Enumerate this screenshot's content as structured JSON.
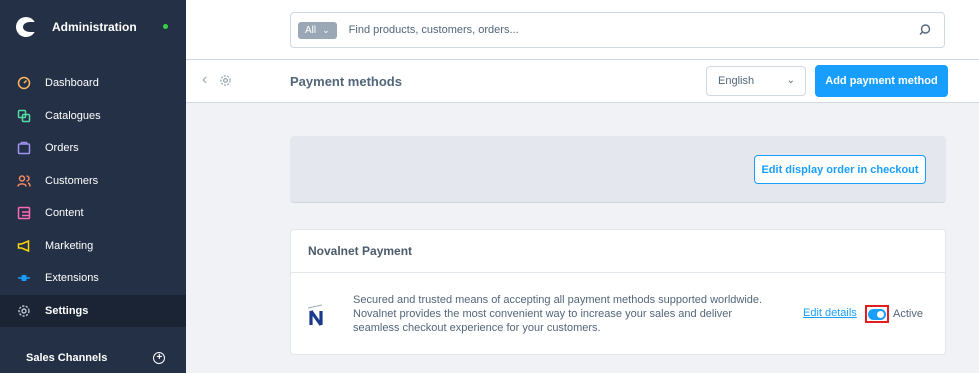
{
  "sidebar": {
    "title": "Administration",
    "items": [
      {
        "label": "Dashboard",
        "icon": "dashboard-icon",
        "color": "#ffb75d"
      },
      {
        "label": "Catalogues",
        "icon": "catalogue-icon",
        "color": "#57d9a3"
      },
      {
        "label": "Orders",
        "icon": "orders-icon",
        "color": "#a092f0"
      },
      {
        "label": "Customers",
        "icon": "customers-icon",
        "color": "#f88962"
      },
      {
        "label": "Content",
        "icon": "content-icon",
        "color": "#ff68b4"
      },
      {
        "label": "Marketing",
        "icon": "marketing-icon",
        "color": "#ffd700"
      },
      {
        "label": "Extensions",
        "icon": "extensions-icon",
        "color": "#189eff"
      },
      {
        "label": "Settings",
        "icon": "settings-icon",
        "color": "#9aa8b5"
      }
    ],
    "sales_channels_label": "Sales Channels",
    "status_color": "#37d046"
  },
  "search": {
    "type_label": "All",
    "placeholder": "Find products, customers, orders..."
  },
  "smartbar": {
    "title": "Payment methods",
    "language": "English",
    "add_button_label": "Add payment method"
  },
  "content": {
    "edit_order_label": "Edit display order in checkout",
    "payment": {
      "name": "Novalnet Payment",
      "description": "Secured and trusted means of accepting all payment methods supported worldwide. Novalnet provides the most convenient way to increase your sales and deliver seamless checkout experience for your customers.",
      "edit_details_label": "Edit details",
      "active_label": "Active",
      "active": true
    }
  },
  "colors": {
    "accent": "#189eff",
    "sidebar_bg": "#233045",
    "highlight_border": "#e02020"
  }
}
